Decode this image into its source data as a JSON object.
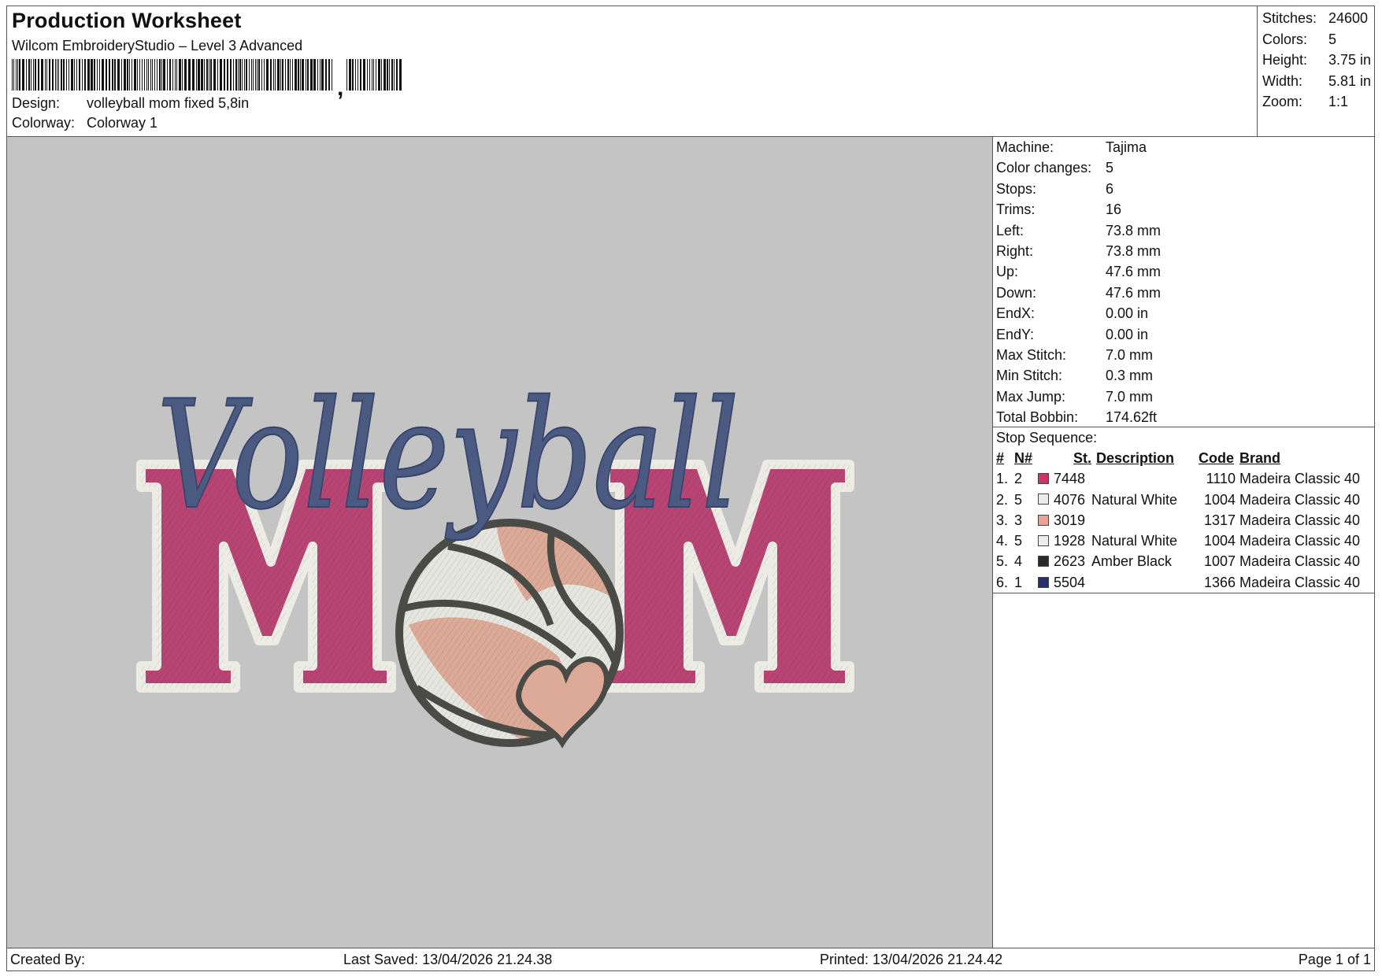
{
  "header": {
    "title": "Production Worksheet",
    "app": "Wilcom EmbroideryStudio – Level 3 Advanced",
    "design_label": "Design:",
    "design_value": "volleyball mom fixed 5,8in",
    "colorway_label": "Colorway:",
    "colorway_value": "Colorway 1"
  },
  "summary": [
    {
      "label": "Stitches:",
      "value": "24600"
    },
    {
      "label": "Colors:",
      "value": "5"
    },
    {
      "label": "Height:",
      "value": "3.75 in"
    },
    {
      "label": "Width:",
      "value": "5.81 in"
    },
    {
      "label": "Zoom:",
      "value": "1:1"
    }
  ],
  "design": {
    "script_text": "Volleyball",
    "block_letter_1": "M",
    "block_letter_2": "M",
    "colors": {
      "background": "#c4c4c4",
      "pink": "#b74574",
      "white": "#e6e6e0",
      "peach": "#dcaa96",
      "black": "#4a4a47",
      "navy": "#4a5a80"
    }
  },
  "machine_info": [
    {
      "label": "Machine:",
      "value": "Tajima"
    },
    {
      "label": "Color changes:",
      "value": "5"
    },
    {
      "label": "Stops:",
      "value": "6"
    },
    {
      "label": "Trims:",
      "value": "16"
    },
    {
      "label": "Left:",
      "value": "73.8 mm"
    },
    {
      "label": "Right:",
      "value": "73.8 mm"
    },
    {
      "label": "Up:",
      "value": "47.6 mm"
    },
    {
      "label": "Down:",
      "value": "47.6 mm"
    },
    {
      "label": "EndX:",
      "value": "0.00 in"
    },
    {
      "label": "EndY:",
      "value": "0.00 in"
    },
    {
      "label": "Max Stitch:",
      "value": "7.0 mm"
    },
    {
      "label": "Min Stitch:",
      "value": "0.3 mm"
    },
    {
      "label": "Max Jump:",
      "value": "7.0 mm"
    },
    {
      "label": "Total Bobbin:",
      "value": "174.62ft"
    }
  ],
  "stop_sequence": {
    "label": "Stop Sequence:",
    "headers": {
      "num": "#",
      "n": "N#",
      "st": "St.",
      "desc": "Description",
      "code": "Code",
      "brand": "Brand"
    },
    "rows": [
      {
        "num": "1.",
        "n": "2",
        "color": "#c8376a",
        "st": "7448",
        "desc": "",
        "code": "1110",
        "brand": "Madeira Classic 40"
      },
      {
        "num": "2.",
        "n": "5",
        "color": "#ecebef",
        "st": "4076",
        "desc": "Natural White",
        "code": "1004",
        "brand": "Madeira Classic 40"
      },
      {
        "num": "3.",
        "n": "3",
        "color": "#e9a29a",
        "st": "3019",
        "desc": "",
        "code": "1317",
        "brand": "Madeira Classic 40"
      },
      {
        "num": "4.",
        "n": "5",
        "color": "#ecebef",
        "st": "1928",
        "desc": "Natural White",
        "code": "1004",
        "brand": "Madeira Classic 40"
      },
      {
        "num": "5.",
        "n": "4",
        "color": "#2a2a2a",
        "st": "2623",
        "desc": "Amber Black",
        "code": "1007",
        "brand": "Madeira Classic 40"
      },
      {
        "num": "6.",
        "n": "1",
        "color": "#27306a",
        "st": "5504",
        "desc": "",
        "code": "1366",
        "brand": "Madeira Classic 40"
      }
    ]
  },
  "footer": {
    "created_by": "Created By:",
    "last_saved": "Last Saved: 13/04/2026 21.24.38",
    "printed": "Printed: 13/04/2026 21.24.42",
    "page": "Page 1 of 1"
  }
}
